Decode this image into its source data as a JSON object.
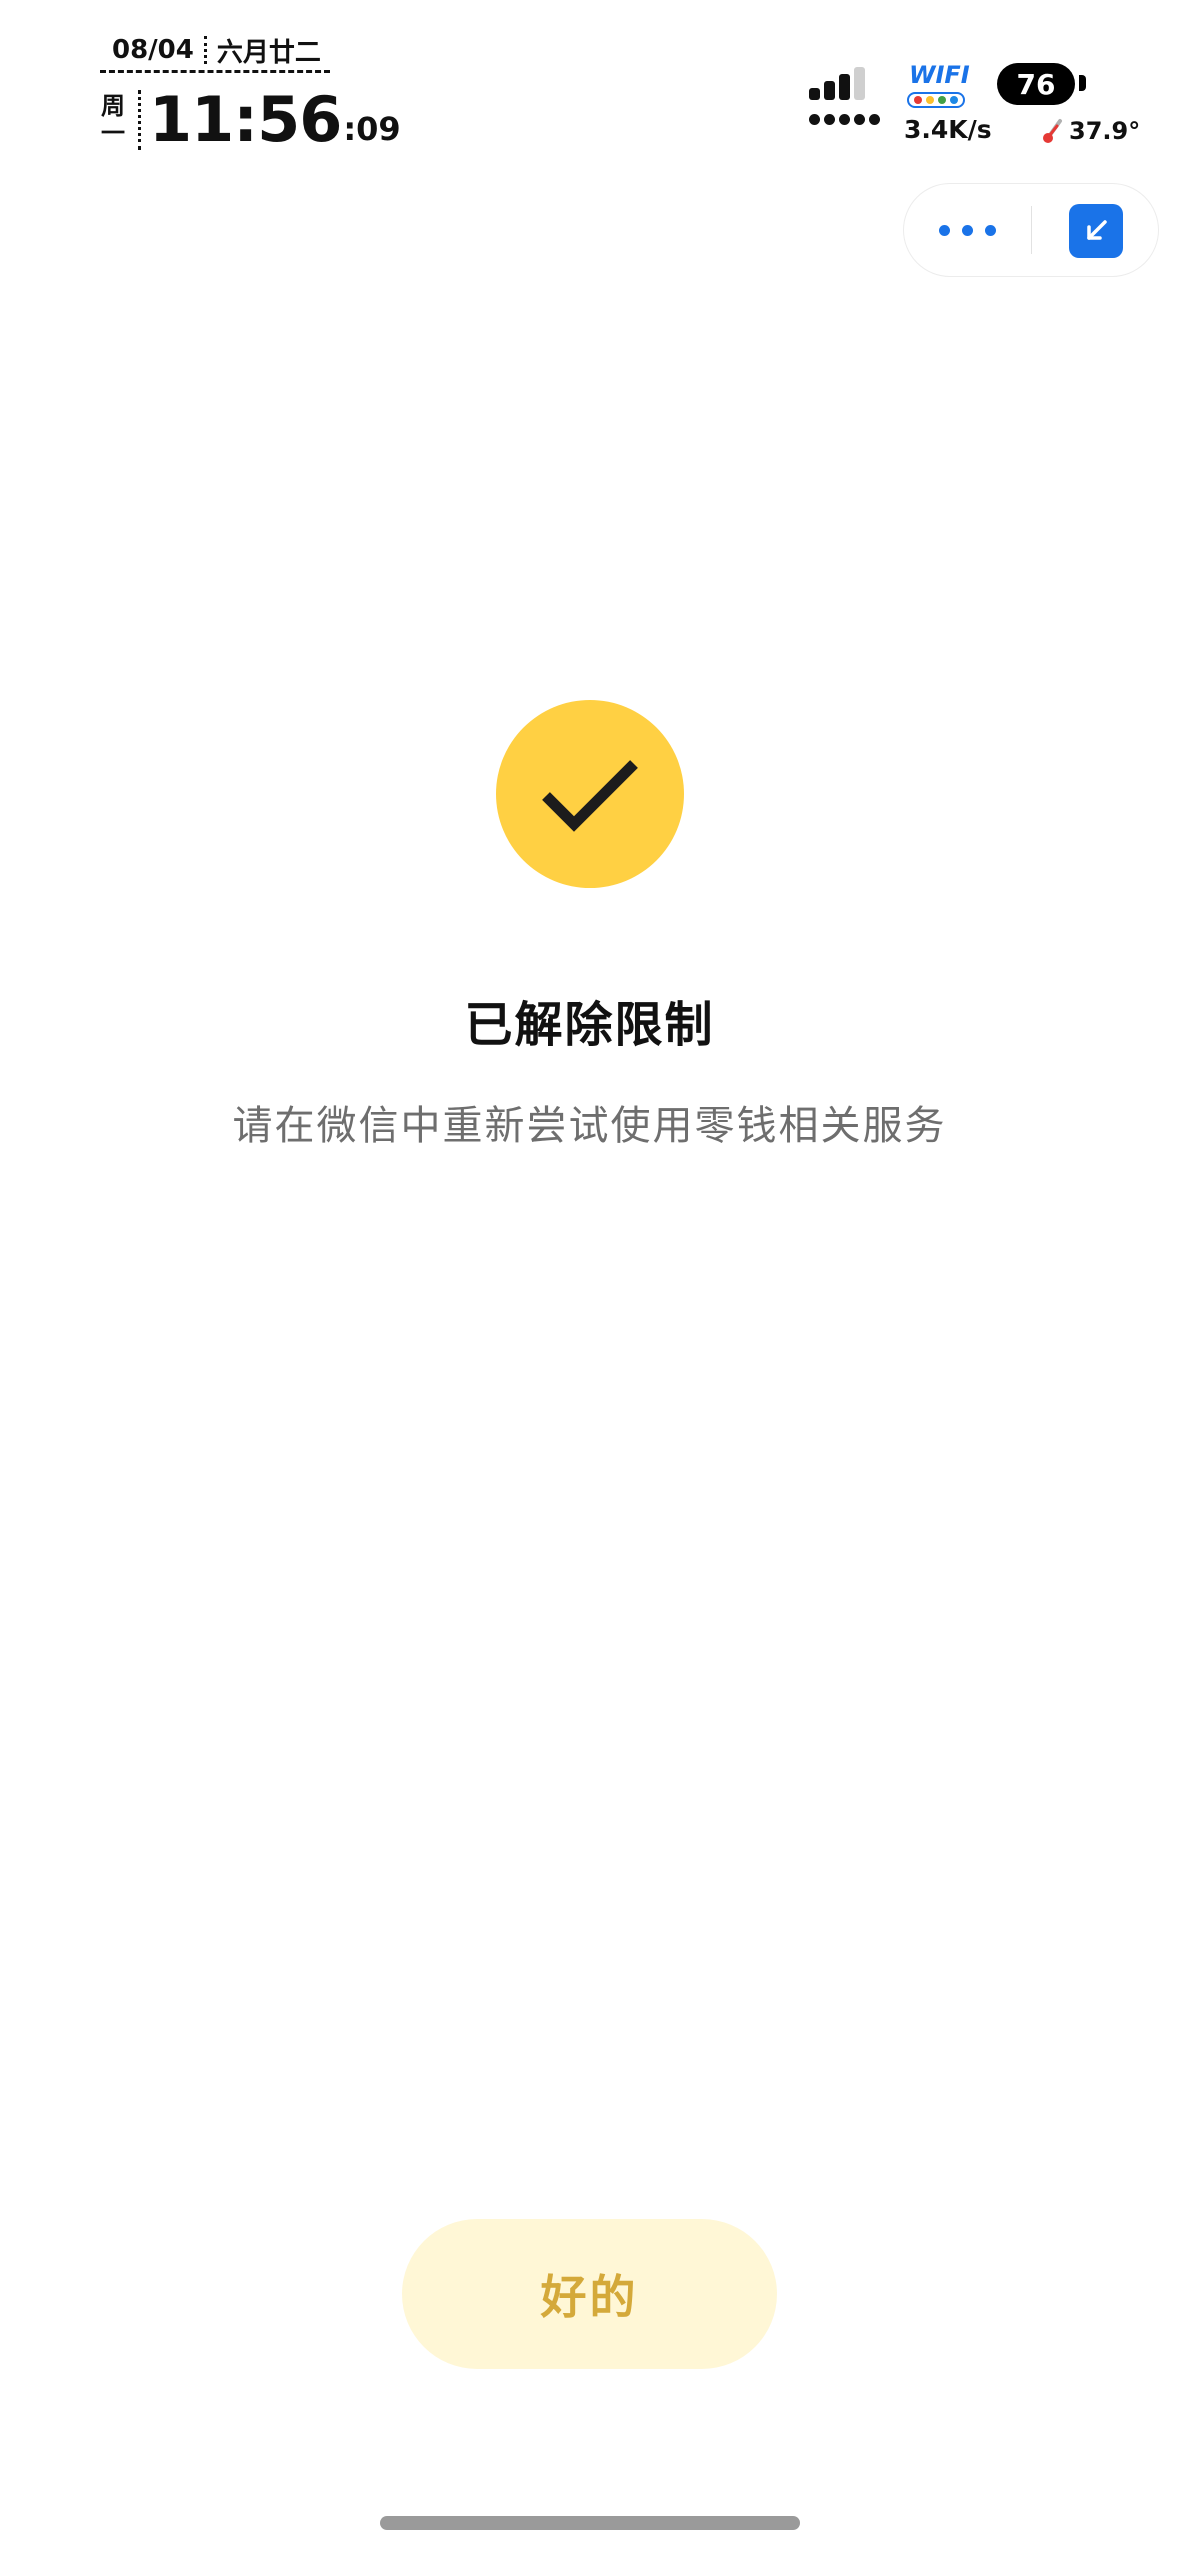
{
  "status_bar": {
    "date": "08/04",
    "lunar_date": "六月廿二",
    "weekday": "周一",
    "time": "11:56",
    "seconds": ":09",
    "wifi_label": "WIFI",
    "battery_level": "76",
    "net_speed": "3.4K/s",
    "temperature": "37.9°",
    "signal_bars": 4,
    "signal_filled": 3
  },
  "capsule": {
    "more_icon": "more-dots-icon",
    "minimize_icon": "minimize-arrow-icon"
  },
  "result": {
    "icon": "checkmark-icon",
    "title": "已解除限制",
    "description": "请在微信中重新尝试使用零钱相关服务"
  },
  "actions": {
    "ok_label": "好的"
  },
  "colors": {
    "accent_blue": "#1a73e8",
    "success_yellow": "#ffd043",
    "button_bg": "#fff7d6",
    "button_text": "#d4a93a",
    "description_gray": "#6e6e6e"
  }
}
